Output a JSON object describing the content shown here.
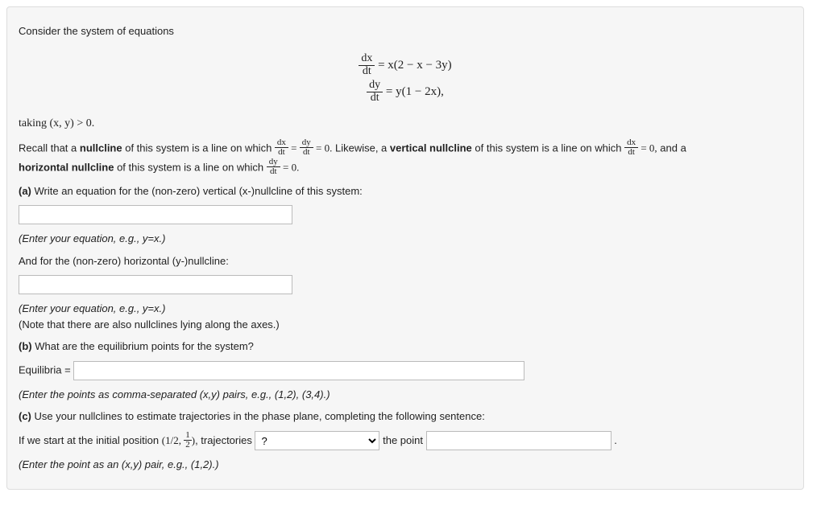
{
  "intro": "Consider the system of equations",
  "eq1_lhs_num": "dx",
  "eq1_lhs_den": "dt",
  "eq1_rhs": "= x(2 − x − 3y)",
  "eq2_lhs_num": "dy",
  "eq2_lhs_den": "dt",
  "eq2_rhs": "= y(1 − 2x),",
  "taking": "taking (x, y) > 0.",
  "recall_part1": "Recall that a ",
  "recall_nullcline_bold": "nullcline",
  "recall_part2": " of this system is a line on which ",
  "recall_eqA_lhs_num": "dx",
  "recall_eqA_lhs_den": "dt",
  "recall_eqA_mid": " = ",
  "recall_eqA_rhs_num": "dy",
  "recall_eqA_rhs_den": "dt",
  "recall_eqA_end": " = 0.",
  "recall_part3": " Likewise, a ",
  "recall_vnull_bold": "vertical nullcline",
  "recall_part4": " of this system is a line on which ",
  "recall_eqB_num": "dx",
  "recall_eqB_den": "dt",
  "recall_eqB_end": " = 0,",
  "recall_part5": " and a ",
  "recall_hnull_bold": "horizontal nullcline",
  "recall_part6": " of this system is a line on which ",
  "recall_eqC_num": "dy",
  "recall_eqC_den": "dt",
  "recall_eqC_end": " = 0.",
  "partA_label": "(a)",
  "partA_text": " Write an equation for the (non-zero) vertical (x-)nullcline of this system:",
  "hintA": "(Enter your equation, e.g., y=x.)",
  "andFor": "And for the (non-zero) horizontal (y-)nullcline:",
  "hintB": "(Enter your equation, e.g., y=x.)",
  "noteNull": "(Note that there are also nullclines lying along the axes.)",
  "partB_label": "(b)",
  "partB_text": " What are the equilibrium points for the system?",
  "equilibria_label": "Equilibria = ",
  "hintC": "(Enter the points as comma-separated (x,y) pairs, e.g., (1,2), (3,4).)",
  "partC_label": "(c)",
  "partC_text": " Use your nullclines to estimate trajectories in the phase plane, completing the following sentence:",
  "partC_sentence1": "If we start at the initial position ",
  "partC_initpoint_open": "(1/2, ",
  "partC_frac_num": "1",
  "partC_frac_den": "2",
  "partC_initpoint_close": ")",
  "partC_sentence2": ", trajectories ",
  "select_placeholder": "?",
  "partC_sentence3": " the point ",
  "partC_sentence4": ".",
  "hintD": "(Enter the point as an (x,y) pair, e.g., (1,2).)"
}
